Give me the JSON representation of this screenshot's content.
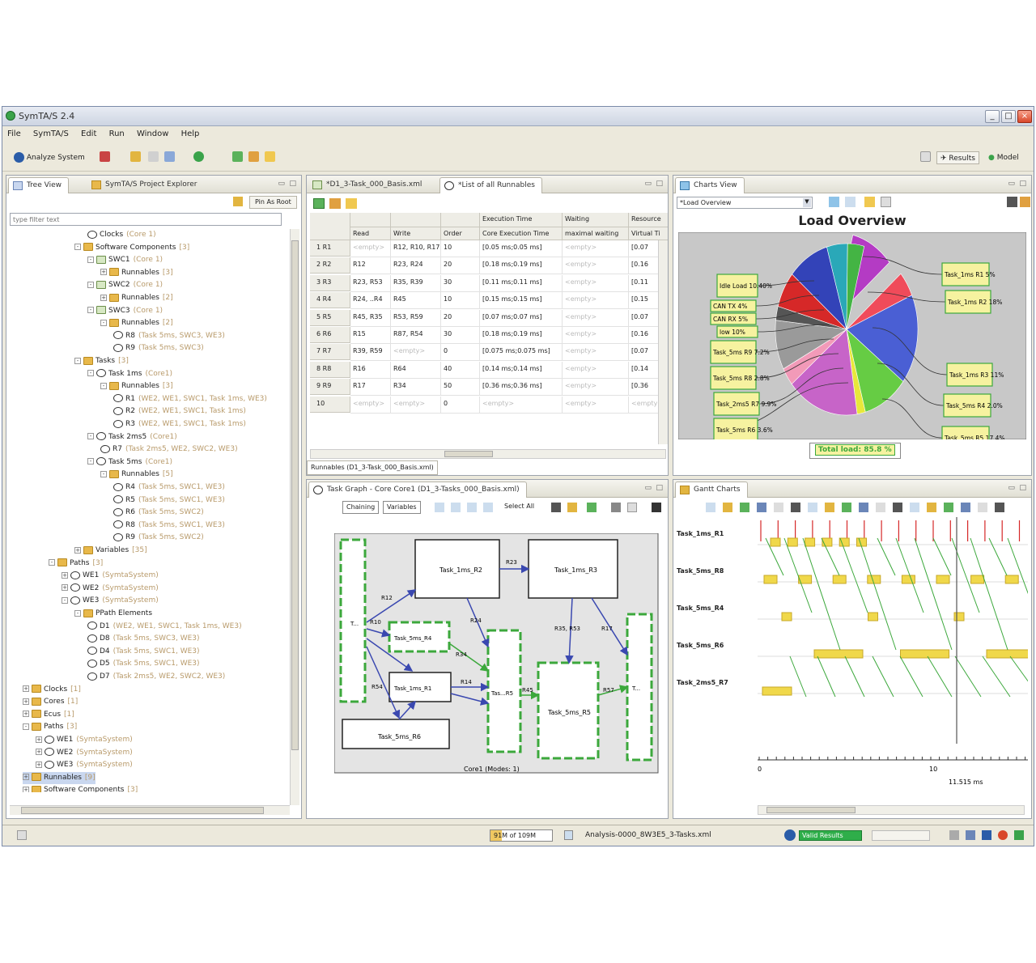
{
  "window": {
    "title": "SymTA/S 2.4"
  },
  "menu": [
    "File",
    "SymTA/S",
    "Edit",
    "Run",
    "Window",
    "Help"
  ],
  "toolbar": {
    "analyze_label": "Analyze System",
    "results_label": "Results",
    "model_label": "Model"
  },
  "tree_panel": {
    "tabs": [
      "Tree View",
      "SymTA/S Project Explorer"
    ],
    "pin_root_label": "Pin As Root",
    "filter_placeholder": "type filter text",
    "rows": [
      {
        "label": "Clocks",
        "extra": "(Core 1)",
        "indent": 6,
        "icon": "cyc",
        "exp": ""
      },
      {
        "label": "Software Components",
        "extra": "[3]",
        "indent": 5,
        "icon": "fold",
        "exp": "-"
      },
      {
        "label": "SWC1",
        "extra": "(Core 1)",
        "indent": 6,
        "icon": "doc",
        "exp": "-"
      },
      {
        "label": "Runnables",
        "extra": "[3]",
        "indent": 7,
        "icon": "fold",
        "exp": "+"
      },
      {
        "label": "SWC2",
        "extra": "(Core 1)",
        "indent": 6,
        "icon": "doc",
        "exp": "-"
      },
      {
        "label": "Runnables",
        "extra": "[2]",
        "indent": 7,
        "icon": "fold",
        "exp": "+"
      },
      {
        "label": "SWC3",
        "extra": "(Core 1)",
        "indent": 6,
        "icon": "doc",
        "exp": "-"
      },
      {
        "label": "Runnables",
        "extra": "[2]",
        "indent": 7,
        "icon": "fold",
        "exp": "-"
      },
      {
        "label": "R8",
        "extra": "(Task 5ms, SWC3, WE3)",
        "indent": 8,
        "icon": "cyc",
        "exp": ""
      },
      {
        "label": "R9",
        "extra": "(Task 5ms, SWC3)",
        "indent": 8,
        "icon": "cyc",
        "exp": ""
      },
      {
        "label": "Tasks",
        "extra": "[3]",
        "indent": 5,
        "icon": "fold",
        "exp": "-"
      },
      {
        "label": "Task 1ms",
        "extra": "(Core1)",
        "indent": 6,
        "icon": "cyc",
        "exp": "-"
      },
      {
        "label": "Runnables",
        "extra": "[3]",
        "indent": 7,
        "icon": "fold",
        "exp": "-"
      },
      {
        "label": "R1",
        "extra": "(WE2, WE1, SWC1, Task 1ms, WE3)",
        "indent": 8,
        "icon": "cyc",
        "exp": ""
      },
      {
        "label": "R2",
        "extra": "(WE2, WE1, SWC1, Task 1ms)",
        "indent": 8,
        "icon": "cyc",
        "exp": ""
      },
      {
        "label": "R3",
        "extra": "(WE2, WE1, SWC1, Task 1ms)",
        "indent": 8,
        "icon": "cyc",
        "exp": ""
      },
      {
        "label": "Task 2ms5",
        "extra": "(Core1)",
        "indent": 6,
        "icon": "cyc",
        "exp": "-"
      },
      {
        "label": "R7",
        "extra": "(Task 2ms5, WE2, SWC2, WE3)",
        "indent": 7,
        "icon": "cyc",
        "exp": ""
      },
      {
        "label": "Task 5ms",
        "extra": "(Core1)",
        "indent": 6,
        "icon": "cyc",
        "exp": "-"
      },
      {
        "label": "Runnables",
        "extra": "[5]",
        "indent": 7,
        "icon": "fold",
        "exp": "-"
      },
      {
        "label": "R4",
        "extra": "(Task 5ms, SWC1, WE3)",
        "indent": 8,
        "icon": "cyc",
        "exp": ""
      },
      {
        "label": "R5",
        "extra": "(Task 5ms, SWC1, WE3)",
        "indent": 8,
        "icon": "cyc",
        "exp": ""
      },
      {
        "label": "R6",
        "extra": "(Task 5ms, SWC2)",
        "indent": 8,
        "icon": "cyc",
        "exp": ""
      },
      {
        "label": "R8",
        "extra": "(Task 5ms, SWC1, WE3)",
        "indent": 8,
        "icon": "cyc",
        "exp": ""
      },
      {
        "label": "R9",
        "extra": "(Task 5ms, SWC2)",
        "indent": 8,
        "icon": "cyc",
        "exp": ""
      },
      {
        "label": "Variables",
        "extra": "[35]",
        "indent": 5,
        "icon": "fold",
        "exp": "+"
      },
      {
        "label": "Paths",
        "extra": "[3]",
        "indent": 3,
        "icon": "fold",
        "exp": "-"
      },
      {
        "label": "WE1",
        "extra": "(SymtaSystem)",
        "indent": 4,
        "icon": "cyc",
        "exp": "+"
      },
      {
        "label": "WE2",
        "extra": "(SymtaSystem)",
        "indent": 4,
        "icon": "cyc",
        "exp": "+"
      },
      {
        "label": "WE3",
        "extra": "(SymtaSystem)",
        "indent": 4,
        "icon": "cyc",
        "exp": "-"
      },
      {
        "label": "PPath Elements",
        "extra": "",
        "indent": 5,
        "icon": "fold",
        "exp": "-"
      },
      {
        "label": "D1",
        "extra": "(WE2, WE1, SWC1, Task 1ms, WE3)",
        "indent": 6,
        "icon": "cyc",
        "exp": ""
      },
      {
        "label": "D8",
        "extra": "(Task 5ms, SWC3, WE3)",
        "indent": 6,
        "icon": "cyc",
        "exp": ""
      },
      {
        "label": "D4",
        "extra": "(Task 5ms, SWC1, WE3)",
        "indent": 6,
        "icon": "cyc",
        "exp": ""
      },
      {
        "label": "D5",
        "extra": "(Task 5ms, SWC1, WE3)",
        "indent": 6,
        "icon": "cyc",
        "exp": ""
      },
      {
        "label": "D7",
        "extra": "(Task 2ms5, WE2, SWC2, WE3)",
        "indent": 6,
        "icon": "cyc",
        "exp": ""
      },
      {
        "label": "Clocks",
        "extra": "[1]",
        "indent": 1,
        "icon": "fold",
        "exp": "+"
      },
      {
        "label": "Cores",
        "extra": "[1]",
        "indent": 1,
        "icon": "fold",
        "exp": "+"
      },
      {
        "label": "Ecus",
        "extra": "[1]",
        "indent": 1,
        "icon": "fold",
        "exp": "+"
      },
      {
        "label": "Paths",
        "extra": "[3]",
        "indent": 1,
        "icon": "fold",
        "exp": "-"
      },
      {
        "label": "WE1",
        "extra": "(SymtaSystem)",
        "indent": 2,
        "icon": "cyc",
        "exp": "+"
      },
      {
        "label": "WE2",
        "extra": "(SymtaSystem)",
        "indent": 2,
        "icon": "cyc",
        "exp": "+"
      },
      {
        "label": "WE3",
        "extra": "(SymtaSystem)",
        "indent": 2,
        "icon": "cyc",
        "exp": "+"
      },
      {
        "label": "Runnables",
        "extra": "[9]",
        "indent": 1,
        "icon": "fold",
        "exp": "+"
      },
      {
        "label": "Software Components",
        "extra": "[3]",
        "indent": 1,
        "icon": "fold",
        "exp": "+"
      }
    ]
  },
  "editor": {
    "tabs": [
      "*D1_3-Task_000_Basis.xml",
      "*List of all Runnables"
    ],
    "group_headers": [
      "Execution Time",
      "Waiting",
      "Resource"
    ],
    "columns": [
      "Read",
      "Write",
      "Order",
      "Core Execution Time",
      "maximal waiting",
      "Virtual Ti"
    ],
    "rows": [
      {
        "id": "1 R1",
        "read": "<empty>",
        "write": "R12, R10, R17",
        "order": "10",
        "cet": "[0.05 ms;0.05 ms]",
        "wait": "<empty>",
        "res": "[0.07"
      },
      {
        "id": "2 R2",
        "read": "R12",
        "write": "R23, R24",
        "order": "20",
        "cet": "[0.18 ms;0.19 ms]",
        "wait": "<empty>",
        "res": "[0.16"
      },
      {
        "id": "3 R3",
        "read": "R23, R53",
        "write": "R35, R39",
        "order": "30",
        "cet": "[0.11 ms;0.11 ms]",
        "wait": "<empty>",
        "res": "[0.11"
      },
      {
        "id": "4 R4",
        "read": "R24, ..R4",
        "write": "R45",
        "order": "10",
        "cet": "[0.15 ms;0.15 ms]",
        "wait": "<empty>",
        "res": "[0.15"
      },
      {
        "id": "5 R5",
        "read": "R45, R35",
        "write": "R53, R59",
        "order": "20",
        "cet": "[0.07 ms;0.07 ms]",
        "wait": "<empty>",
        "res": "[0.07"
      },
      {
        "id": "6 R6",
        "read": "R15",
        "write": "R87, R54",
        "order": "30",
        "cet": "[0.18 ms;0.19 ms]",
        "wait": "<empty>",
        "res": "[0.16"
      },
      {
        "id": "7 R7",
        "read": "R39, R59",
        "write": "<empty>",
        "order": "0",
        "cet": "[0.075 ms;0.075 ms]",
        "wait": "<empty>",
        "res": "[0.07"
      },
      {
        "id": "8 R8",
        "read": "R16",
        "write": "R64",
        "order": "40",
        "cet": "[0.14 ms;0.14 ms]",
        "wait": "<empty>",
        "res": "[0.14"
      },
      {
        "id": "9 R9",
        "read": "R17",
        "write": "R34",
        "order": "50",
        "cet": "[0.36 ms;0.36 ms]",
        "wait": "<empty>",
        "res": "[0.36"
      },
      {
        "id": "10",
        "read": "<empty>",
        "write": "<empty>",
        "order": "0",
        "cet": "<empty>",
        "wait": "<empty>",
        "res": "<empty>"
      }
    ],
    "bottom_tab": "Runnables (D1_3-Task_000_Basis.xml)"
  },
  "charts_view": {
    "tab": "Charts View",
    "selector_value": "*Load Overview",
    "title": "Load Overview",
    "total_load": "Total load: 85.8 %",
    "chart_data": {
      "type": "pie",
      "title": "Load Overview",
      "slices": [
        {
          "label": "Idle Load",
          "value": 10.4,
          "color": "#b43bc4"
        },
        {
          "label": "Task_1ms R1",
          "value": 5.0,
          "color": "#f04b5a"
        },
        {
          "label": "Task_1ms R2",
          "value": 18.0,
          "color": "#4a5fd4"
        },
        {
          "label": "Task_1ms R3",
          "value": 11.0,
          "color": "#66cc44"
        },
        {
          "label": "Task_5ms R4",
          "value": 2.0,
          "color": "#e8e83a"
        },
        {
          "label": "Task_5ms R5",
          "value": 17.4,
          "color": "#c764c8"
        },
        {
          "label": "Task_5ms R6",
          "value": 3.6,
          "color": "#f29ab8"
        },
        {
          "label": "Task_2ms5 R7",
          "value": 9.9,
          "color": "#9a9a9a"
        },
        {
          "label": "Task_5ms R8",
          "value": 2.8,
          "color": "#555555"
        },
        {
          "label": "Task_5ms R9",
          "value": 7.2,
          "color": "#d62828"
        },
        {
          "label": "low",
          "value": 10.0,
          "color": "#3343b8"
        },
        {
          "label": "CAN RX",
          "value": 5.0,
          "color": "#2aa8b8"
        },
        {
          "label": "CAN TX",
          "value": 4.0,
          "color": "#44b444"
        }
      ]
    },
    "labels_left": [
      "Idle Load 10.40%",
      "CAN TX 4%",
      "CAN RX 5%",
      "low 10%",
      "Task_5ms R9 7.2%",
      "Task_5ms R8 2.8%",
      "Task_2ms5 R7 9.9%",
      "Task_5ms R6 3.6%"
    ],
    "labels_right": [
      "Task_1ms R1 5%",
      "Task_1ms R2 18%",
      "Task_1ms R3 11%",
      "Task_5ms R4 2.0%",
      "Task_5ms R5 17.4%"
    ]
  },
  "task_graph": {
    "tab": "Task Graph - Core Core1 (D1_3-Tasks_000_Basis.xml)",
    "buttons": [
      "Chaining",
      "Variables",
      "Select All"
    ],
    "nodes": [
      "Task_1ms_R2",
      "Task_1ms_R3",
      "Task_5ms_R4",
      "Task_1ms_R1",
      "Task_5ms_R5",
      "Task_5ms_R6",
      "T...",
      "Tas...R5",
      "T..."
    ],
    "edge_labels": [
      "R23",
      "R12",
      "R10",
      "R24",
      "R34",
      "R35, R53",
      "R17",
      "R54",
      "R45",
      "R14",
      "R57"
    ],
    "footer": "Core1 (Modes: 1)"
  },
  "gantt": {
    "tab": "Gantt Charts",
    "tasks": [
      "Task_1ms_R1",
      "Task_5ms_R8",
      "Task_5ms_R4",
      "Task_5ms_R6",
      "Task_2ms5_R7"
    ],
    "axis_ticks": [
      "0",
      "10"
    ],
    "cursor_label": "11.515 ms"
  },
  "statusbar": {
    "memory": "91M of 109M",
    "file": "Analysis-0000_8W3E5_3-Tasks.xml",
    "status": "Valid Results"
  },
  "colors": {
    "accent_green": "#3ca83c",
    "label_box": "#f6f2a0",
    "gantt_bar": "#f0d84a"
  }
}
